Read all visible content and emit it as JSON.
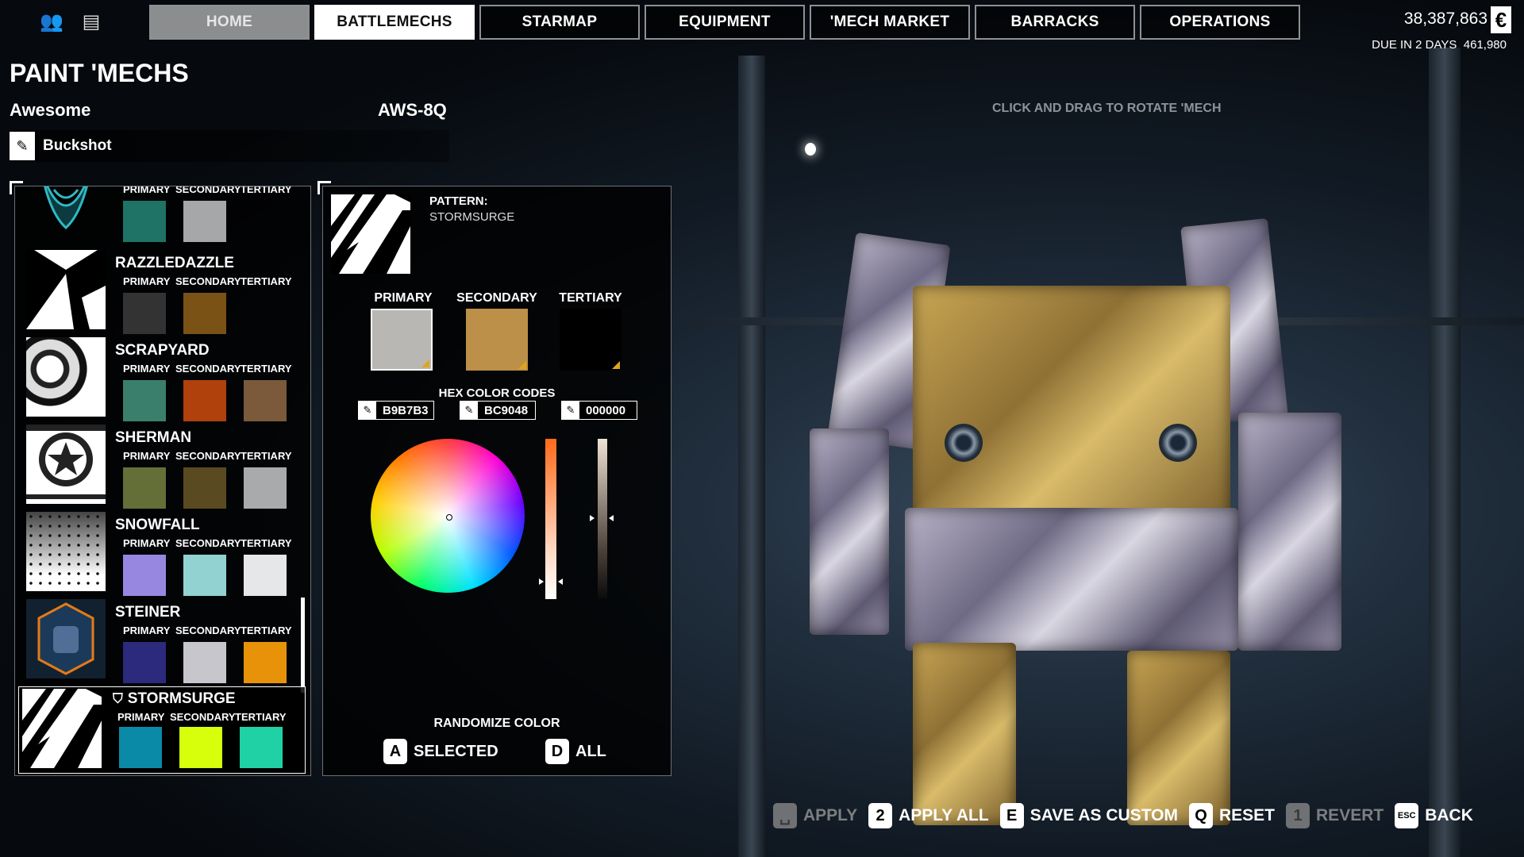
{
  "top_icons": [
    {
      "name": "pilot-roster-icon",
      "glyph": "👥"
    },
    {
      "name": "news-icon",
      "glyph": "▤"
    }
  ],
  "nav": {
    "tabs": [
      {
        "label": "HOME"
      },
      {
        "label": "BATTLEMECHS"
      },
      {
        "label": "STARMAP"
      },
      {
        "label": "EQUIPMENT"
      },
      {
        "label": "'MECH MARKET"
      },
      {
        "label": "BARRACKS"
      },
      {
        "label": "OPERATIONS"
      }
    ],
    "active": "BATTLEMECHS"
  },
  "finance": {
    "balance": "38,387,863",
    "currency_symbol": "€",
    "due_text": "DUE IN 2 DAYS",
    "due_amount": "461,980"
  },
  "header": {
    "title": "PAINT 'MECHS",
    "mech_name": "Awesome",
    "mech_variant": "AWS-8Q",
    "pilot_name": "Buckshot",
    "rotate_hint": "CLICK AND DRAG TO ROTATE 'MECH"
  },
  "swatch_labels": {
    "primary": "PRIMARY",
    "secondary": "SECONDARY",
    "tertiary": "TERTIARY"
  },
  "patterns": [
    {
      "name": "",
      "colors": [
        "#1e7366",
        "#a5a7a9",
        ""
      ]
    },
    {
      "name": "RAZZLEDAZZLE",
      "colors": [
        "#333333",
        "#7a5216",
        ""
      ]
    },
    {
      "name": "SCRAPYARD",
      "colors": [
        "#3a7f6b",
        "#b0400c",
        "#7a5a3a"
      ]
    },
    {
      "name": "SHERMAN",
      "colors": [
        "#636f37",
        "#5a4a22",
        "#a9aaab"
      ]
    },
    {
      "name": "SNOWFALL",
      "colors": [
        "#9787e0",
        "#92d2d0",
        "#e6e7e8"
      ]
    },
    {
      "name": "STEINER",
      "colors": [
        "#2c2a7c",
        "#c8c6cd",
        "#e8920a"
      ]
    }
  ],
  "selected_pattern": {
    "name": "STORMSURGE",
    "colors": [
      "#0b8aa8",
      "#d7fe0a",
      "#1fd1a4"
    ]
  },
  "editor": {
    "pattern_label": "PATTERN:",
    "pattern_value": "STORMSURGE",
    "columns": [
      "PRIMARY",
      "SECONDARY",
      "TERTIARY"
    ],
    "colors": [
      "#B9B7B3",
      "#BC9048",
      "#000000"
    ],
    "hex_title": "HEX COLOR CODES",
    "hex_values": [
      "B9B7B3",
      "BC9048",
      "000000"
    ],
    "randomize_title": "RANDOMIZE COLOR",
    "randomize_selected": {
      "key": "A",
      "label": "SELECTED"
    },
    "randomize_all": {
      "key": "D",
      "label": "ALL"
    }
  },
  "actions": [
    {
      "key": "␣",
      "label": "APPLY",
      "enabled": false
    },
    {
      "key": "2",
      "label": "APPLY ALL",
      "enabled": true
    },
    {
      "key": "E",
      "label": "SAVE AS CUSTOM",
      "enabled": true
    },
    {
      "key": "Q",
      "label": "RESET",
      "enabled": true
    },
    {
      "key": "1",
      "label": "REVERT",
      "enabled": false
    },
    {
      "key": "ESC",
      "label": "BACK",
      "enabled": true
    }
  ]
}
